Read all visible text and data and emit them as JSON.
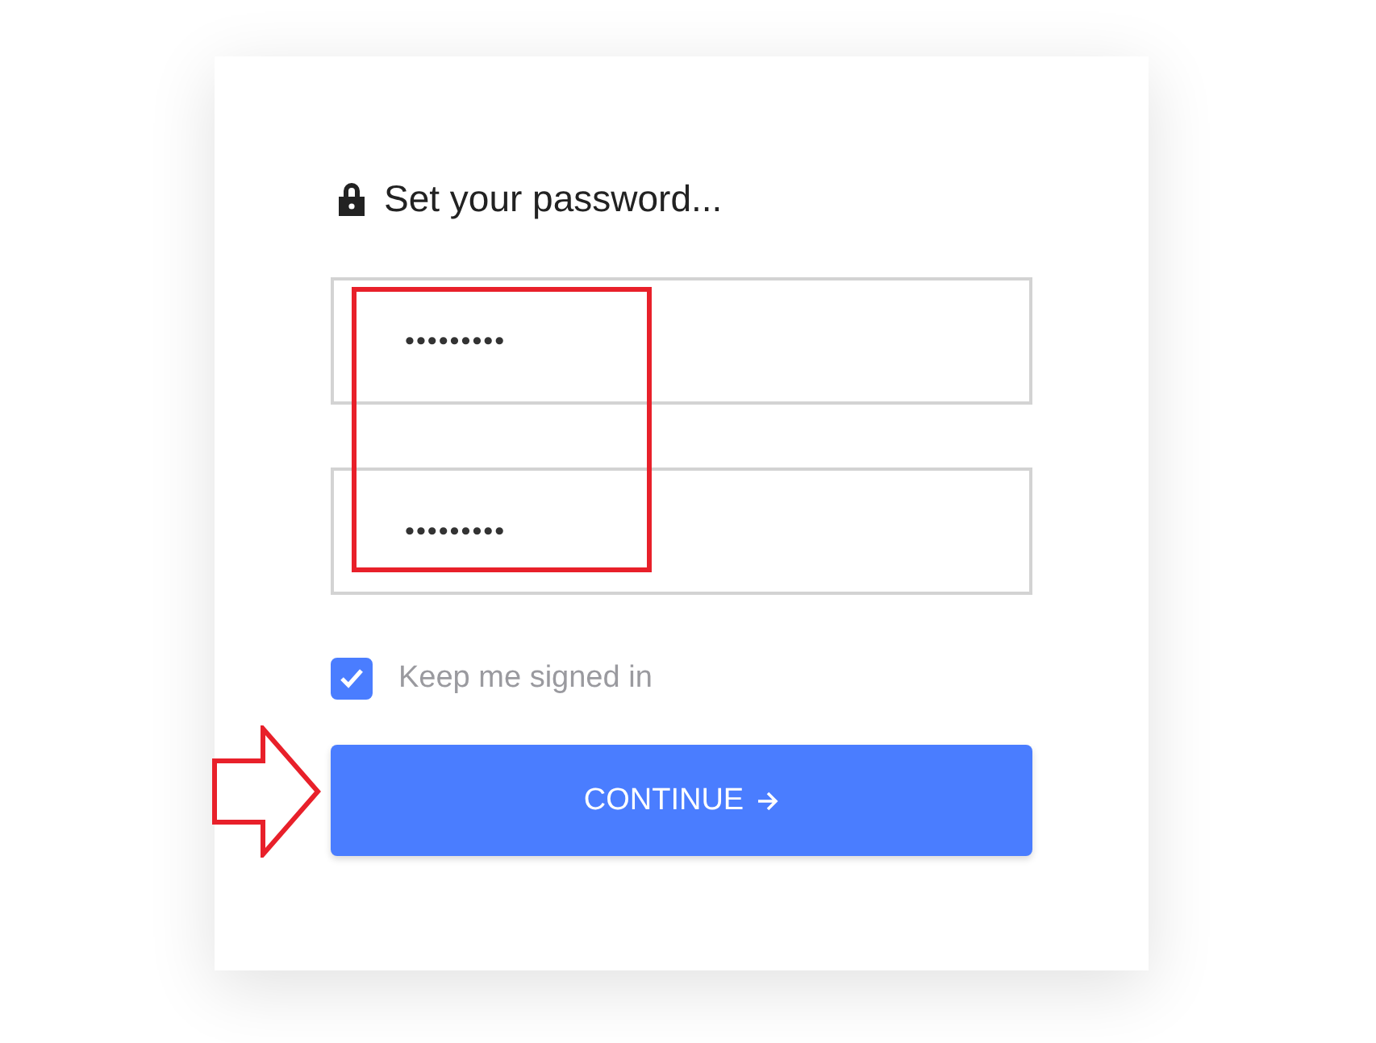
{
  "title": "Set your password...",
  "fields": [
    {
      "value": "•••••••••"
    },
    {
      "value": "•••••••••"
    }
  ],
  "keep_signed_in": {
    "label": "Keep me signed in",
    "checked": true
  },
  "button": {
    "label": "CONTINUE"
  },
  "highlight_box": {
    "color": "#e8202a"
  },
  "pointer_arrow": {
    "color": "#e8202a"
  }
}
